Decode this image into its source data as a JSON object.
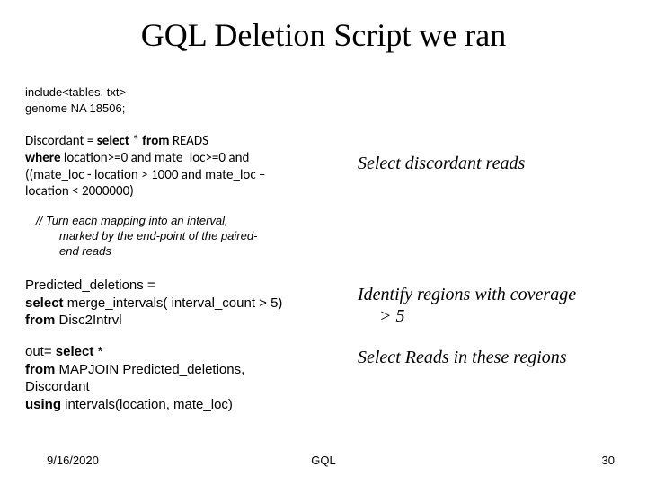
{
  "title": "GQL Deletion Script we ran",
  "code_include": "include<tables. txt>",
  "code_genome": "genome NA 18506;",
  "block1_l1_a": "Discordant = ",
  "block1_l1_b": "select",
  "block1_l1_c": " * ",
  "block1_l1_d": "from",
  "block1_l1_e": " READS",
  "block1_l2_a": "where",
  "block1_l2_b": " location>=0 and mate_loc>=0 and",
  "block1_l3": "((mate_loc - location > 1000 and mate_loc –",
  "block1_l4": "location < 2000000)",
  "comment_l1": "// Turn each mapping into an interval,",
  "comment_l2": "marked by the end-point of the paired-",
  "comment_l3": "end reads",
  "block2_l1": "Predicted_deletions =",
  "block2_l2_a": "select",
  "block2_l2_b": " merge_intervals( interval_count > 5)",
  "block2_l3_a": "from",
  "block2_l3_b": " Disc2Intrvl",
  "block3_l1_a": "out= ",
  "block3_l1_b": "select",
  "block3_l1_c": " *",
  "block3_l2_a": "from",
  "block3_l2_b": " MAPJOIN Predicted_deletions,",
  "block3_l3": "Discordant",
  "block3_l4_a": "using",
  "block3_l4_b": " intervals(location, mate_loc)",
  "ann1": "Select discordant reads",
  "ann2_l1": "Identify regions with coverage",
  "ann2_l2": "> 5",
  "ann3": "Select Reads in these regions",
  "footer_date": "9/16/2020",
  "footer_center": "GQL",
  "footer_num": "30"
}
